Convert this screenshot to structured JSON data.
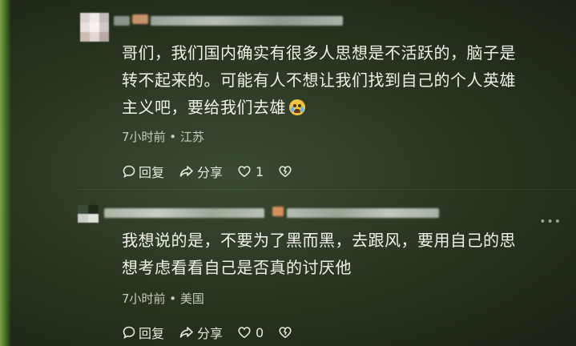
{
  "comments": [
    {
      "text_line1": "哥们，我们国内确实有很多人思想是不活跃的，脑子是",
      "text_line2": "转不起来的。可能有人不想让我们找到自己的个人英雄",
      "text_line3": "主义吧，要给我们去雄",
      "emoji": "crying-face",
      "meta": "7小时前 • 江苏",
      "reply_label": "回复",
      "share_label": "分享",
      "like_count": "1"
    },
    {
      "text_line1": "我想说的是，不要为了黑而黑，去跟风，要用自己的思",
      "text_line2": "想考虑看看自己是否真的讨厌他",
      "meta": "7小时前 • 美国",
      "reply_label": "回复",
      "share_label": "分享",
      "like_count": "0",
      "more_label": "•••"
    }
  ],
  "colors": {
    "background": "#28331f",
    "text": "#f2f2ec",
    "meta": "#c6cbbf"
  }
}
